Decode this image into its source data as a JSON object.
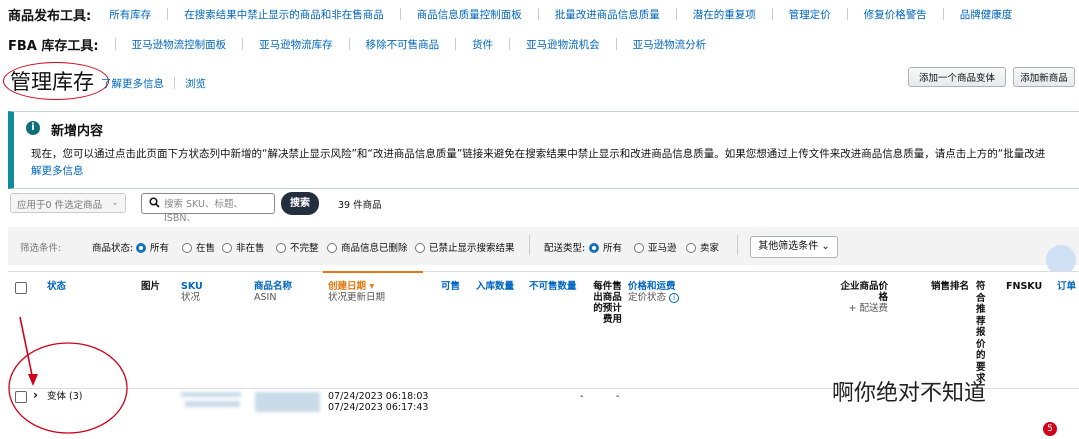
{
  "toolbar1": {
    "label": "商品发布工具:",
    "items": [
      "所有库存",
      "在搜索结果中禁止显示的商品和非在售商品",
      "商品信息质量控制面板",
      "批量改进商品信息质量",
      "潜在的重复项",
      "管理定价",
      "修复价格警告",
      "品牌健康度"
    ]
  },
  "toolbar2": {
    "label": "FBA 库存工具:",
    "items": [
      "亚马逊物流控制面板",
      "亚马逊物流库存",
      "移除不可售商品",
      "货件",
      "亚马逊物流机会",
      "亚马逊物流分析"
    ]
  },
  "header": {
    "title": "管理库存",
    "learn_more": "了解更多信息",
    "browse": "浏览",
    "add_variant": "添加一个商品变体",
    "add_product": "添加新商品"
  },
  "info": {
    "icon": "info-icon",
    "title": "新增内容",
    "body_line1": "现在，您可以通过点击此页面下方状态列中新增的“解决禁止显示风险”和“改进商品信息质量”链接来避免在搜索结果中禁止显示和改进商品信息质量。如果您想通过上传文件来改进商品信息质量，请点击上方的“批量改进",
    "body_line2": "解更多信息"
  },
  "controls": {
    "apply_to": "应用于0 件选定商品",
    "search_placeholder": "搜索 SKU、标题、ISBN、",
    "search_button": "搜索",
    "count": "39 件商品"
  },
  "filters": {
    "label": "筛选条件:",
    "status_label": "商品状态:",
    "status_options": [
      "所有",
      "在售",
      "非在售",
      "不完整",
      "商品信息已删除",
      "已禁止显示搜索结果"
    ],
    "status_selected": "所有",
    "delivery_label": "配送类型:",
    "delivery_options": [
      "所有",
      "亚马逊",
      "卖家"
    ],
    "delivery_selected": "所有",
    "more_filters": "其他筛选条件"
  },
  "table": {
    "headers": {
      "status": "状态",
      "image": "图片",
      "sku": "SKU",
      "sku_sub": "状况",
      "name": "商品名称",
      "name_sub": "ASIN",
      "created": "创建日期",
      "created_sub": "状况更新日期",
      "available": "可售",
      "inbound": "入库数量",
      "unsellable": "不可售数量",
      "fees_1": "每件售",
      "fees_2": "出商品",
      "fees_3": "的预计",
      "fees_4": "费用",
      "price": "价格和运费",
      "price_sub": "定价状态",
      "biz_price": "企业商品价格",
      "biz_price_sub": "+ 配送费",
      "rank": "销售排名",
      "reco": [
        "符",
        "合",
        "推",
        "荐",
        "报",
        "价",
        "的",
        "要",
        "求"
      ],
      "fnsku": "FNSKU",
      "orders": "订单"
    },
    "row": {
      "label": "变体 (3)",
      "date1": "07/24/2023 06:18:03",
      "date2": "07/24/2023 06:17:43",
      "dash1": "-",
      "dash2": "-"
    }
  },
  "watermark": "啊你绝对不知道",
  "badge": "5"
}
